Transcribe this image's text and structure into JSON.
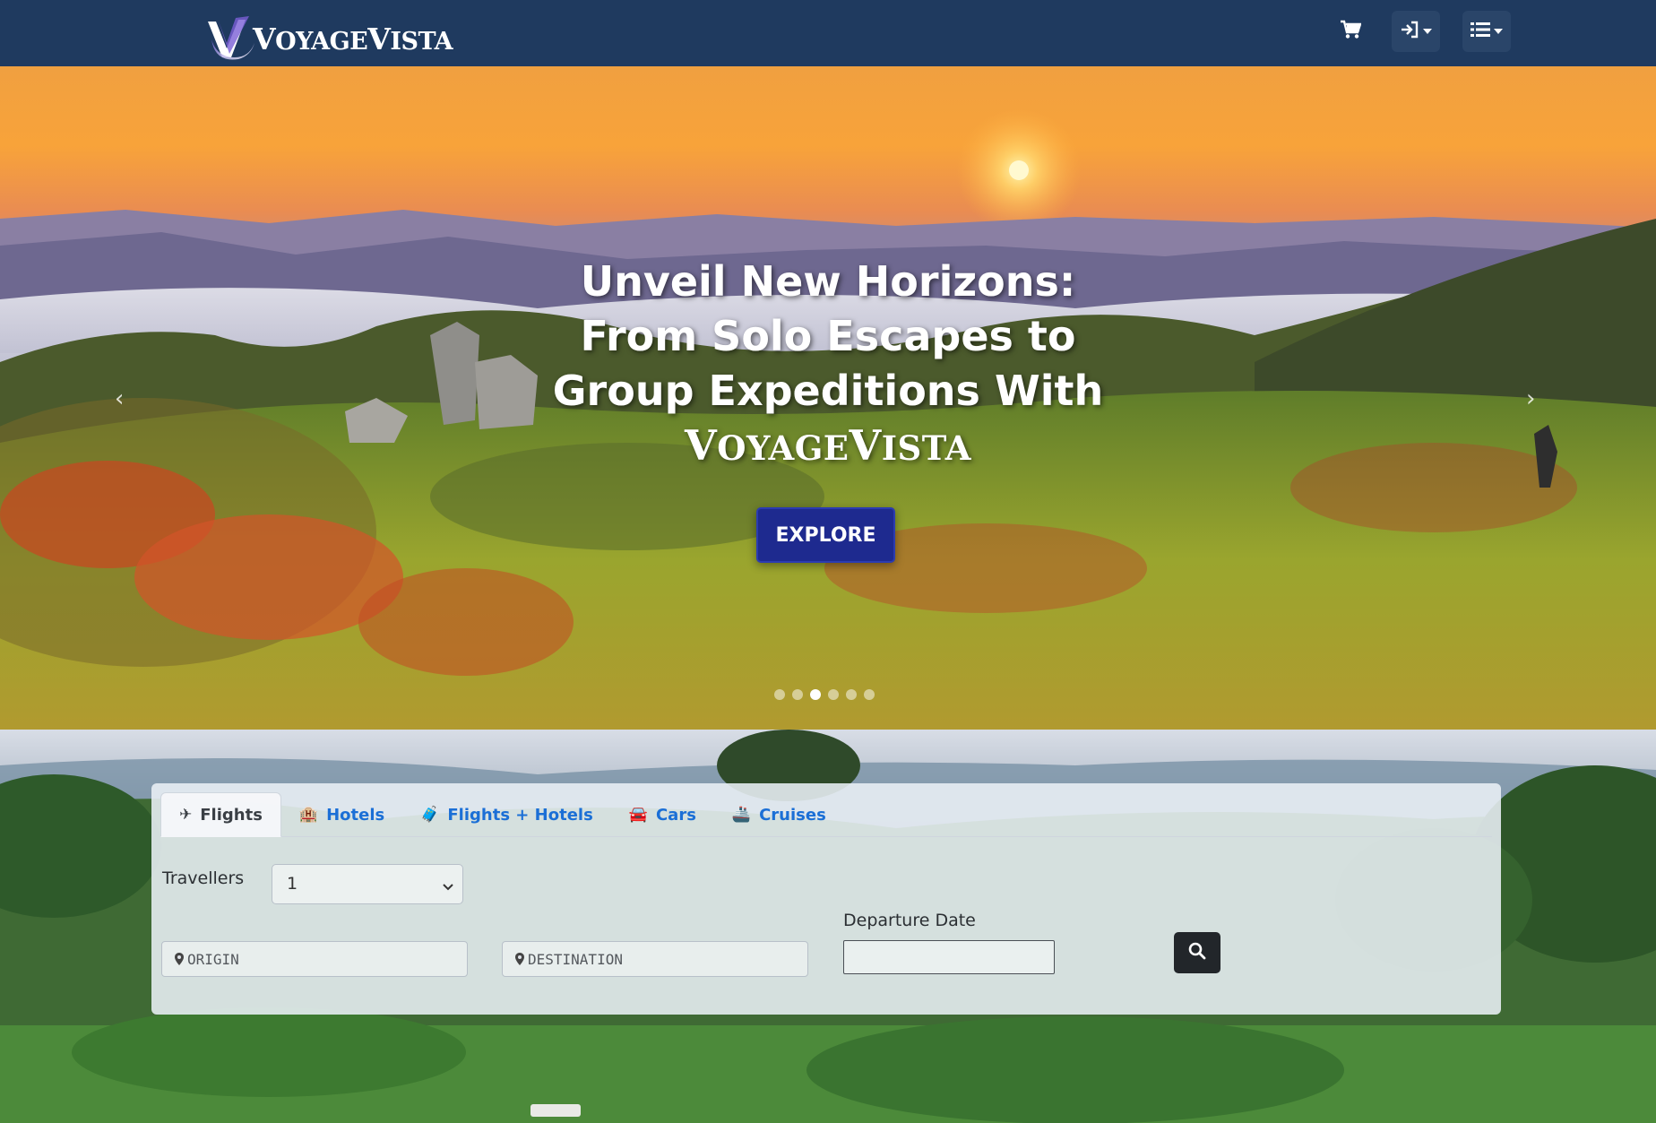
{
  "brand": {
    "first_initial": "V",
    "first_rest": "OYAGE",
    "second_initial": "V",
    "second_rest": "ISTA"
  },
  "nav": {
    "cart_icon": "cart-icon",
    "login_icon": "sign-in-icon",
    "menu_icon": "list-icon"
  },
  "hero": {
    "title_line1": "Unveil New Horizons:",
    "title_line2": "From Solo Escapes to",
    "title_line3": "Group Expeditions With",
    "title_brand_initial1": "V",
    "title_brand_rest1": "OYAGE",
    "title_brand_initial2": "V",
    "title_brand_rest2": "ISTA",
    "explore_label": "EXPLORE",
    "prev_glyph": "‹",
    "next_glyph": "›",
    "active_slide": 3,
    "slide_count": 6
  },
  "search": {
    "tabs": [
      {
        "label": "Flights",
        "icon": "plane-icon",
        "glyph": "✈",
        "active": true
      },
      {
        "label": "Hotels",
        "icon": "hotel-icon",
        "glyph": "🏨",
        "active": false
      },
      {
        "label": "Flights + Hotels",
        "icon": "luggage-icon",
        "glyph": "🧳",
        "active": false
      },
      {
        "label": "Cars",
        "icon": "car-icon",
        "glyph": "🚘",
        "active": false
      },
      {
        "label": "Cruises",
        "icon": "ship-icon",
        "glyph": "🚢",
        "active": false
      }
    ],
    "travellers_label": "Travellers",
    "travellers_value": "1",
    "origin_placeholder": "ORIGIN",
    "destination_placeholder": "DESTINATION",
    "departure_label": "Departure Date",
    "departure_value": ""
  },
  "colors": {
    "navbar": "#1f3a5f",
    "explore_button": "#1e2a8f",
    "tab_link": "#1b6fd6"
  }
}
